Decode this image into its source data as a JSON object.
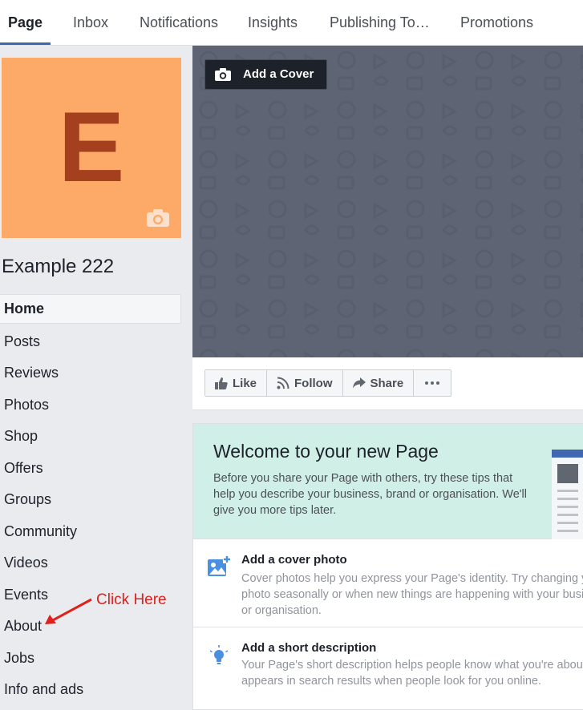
{
  "tabs": [
    {
      "label": "Page",
      "active": true
    },
    {
      "label": "Inbox"
    },
    {
      "label": "Notifications"
    },
    {
      "label": "Insights"
    },
    {
      "label": "Publishing To…"
    },
    {
      "label": "Promotions"
    }
  ],
  "profile": {
    "letter": "E",
    "page_name": "Example 222",
    "background_color": "#fda968",
    "letter_color": "#a4401e"
  },
  "nav": [
    {
      "label": "Home",
      "active": true
    },
    {
      "label": "Posts"
    },
    {
      "label": "Reviews"
    },
    {
      "label": "Photos"
    },
    {
      "label": "Shop"
    },
    {
      "label": "Offers"
    },
    {
      "label": "Groups"
    },
    {
      "label": "Community"
    },
    {
      "label": "Videos"
    },
    {
      "label": "Events"
    },
    {
      "label": "About"
    },
    {
      "label": "Jobs"
    },
    {
      "label": "Info and ads"
    }
  ],
  "annotation": {
    "text": "Click Here",
    "color": "#e0201c"
  },
  "cover": {
    "add_cover_label": "Add a Cover",
    "icon": "camera-icon"
  },
  "actions": {
    "like": "Like",
    "follow": "Follow",
    "share": "Share",
    "more_icon": "more-icon"
  },
  "welcome": {
    "title": "Welcome to your new Page",
    "text": "Before you share your Page with others, try these tips that help you describe your business, brand or organisation. We'll give you more tips later.",
    "background_color": "#d0efe6"
  },
  "tips": [
    {
      "icon": "photo-add-icon",
      "title": "Add a cover photo",
      "desc": "Cover photos help you express your Page's identity. Try changing your photo seasonally or when new things are happening with your business or organisation."
    },
    {
      "icon": "lightbulb-icon",
      "title": "Add a short description",
      "desc": "Your Page's short description helps people know what you're about and appears in search results when people look for you online."
    }
  ]
}
